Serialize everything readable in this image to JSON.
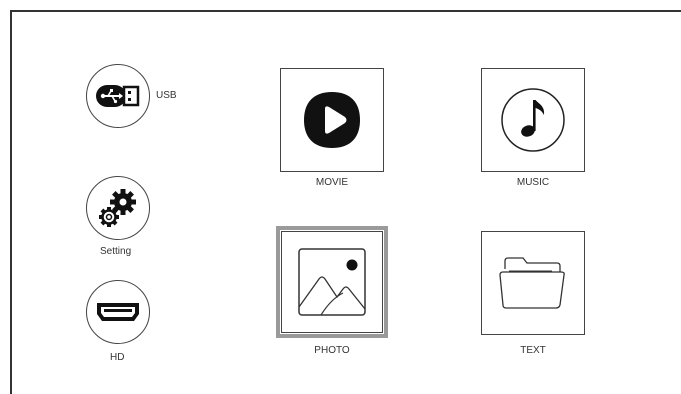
{
  "sources": [
    {
      "id": "usb",
      "label": "USB",
      "icon": "usb-icon"
    },
    {
      "id": "setting",
      "label": "Setting",
      "icon": "gears-icon"
    },
    {
      "id": "hd",
      "label": "HD",
      "icon": "hdmi-icon"
    }
  ],
  "tiles": [
    {
      "id": "movie",
      "label": "MOVIE",
      "icon": "play-icon"
    },
    {
      "id": "music",
      "label": "MUSIC",
      "icon": "music-note-icon"
    },
    {
      "id": "photo",
      "label": "PHOTO",
      "icon": "image-icon",
      "selected": true
    },
    {
      "id": "text",
      "label": "TEXT",
      "icon": "folder-icon"
    }
  ],
  "colors": {
    "border": "#444444",
    "selection": "#9a9a9a",
    "icon_fill": "#111111"
  }
}
